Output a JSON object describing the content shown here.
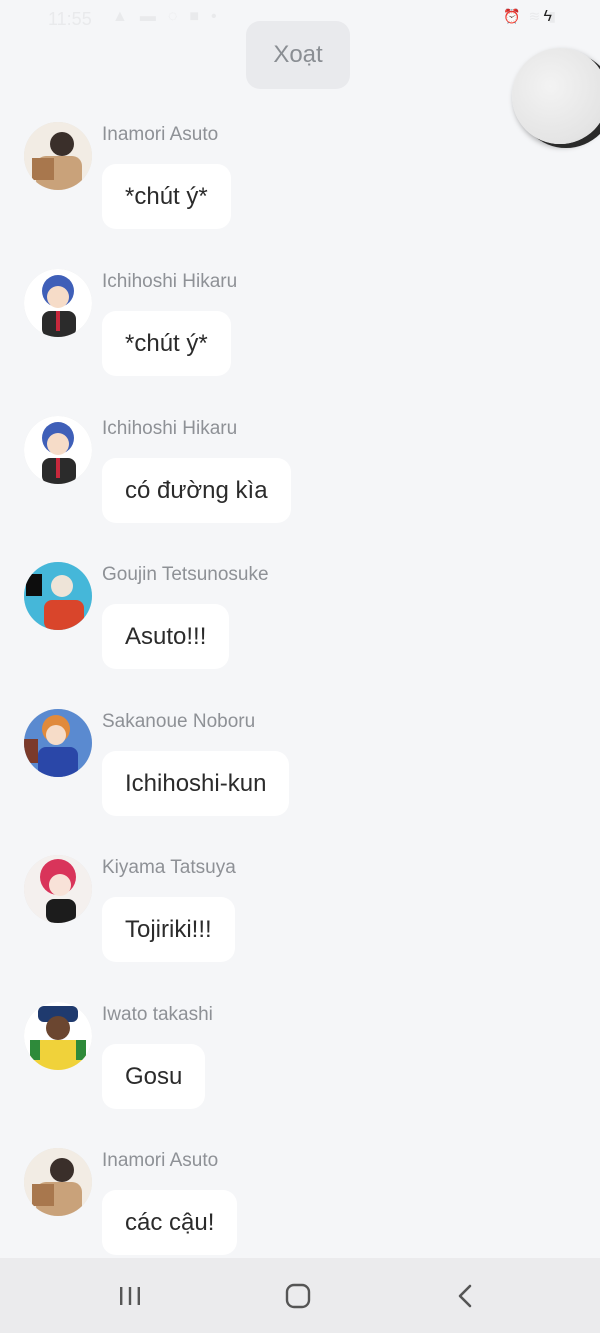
{
  "status_bar": {
    "time": "11:55",
    "left_icons": [
      "warning-icon",
      "message-icon",
      "messenger-icon",
      "facebook-icon",
      "dot-icon"
    ],
    "right_icons": [
      "alarm-icon",
      "wifi-icon",
      "signal-icon",
      "battery-charging-icon"
    ]
  },
  "toolbar": {
    "delete_label": "Xoạt"
  },
  "messages": [
    {
      "sender": "Inamori Asuto",
      "text": "*chút ý*",
      "avatar_color": "#c9a27a"
    },
    {
      "sender": "Ichihoshi Hikaru",
      "text": "*chút ý*",
      "avatar_color": "#3f5fb8"
    },
    {
      "sender": "Ichihoshi Hikaru",
      "text": "có đường kìa",
      "avatar_color": "#3f5fb8"
    },
    {
      "sender": "Goujin Tetsunosuke",
      "text": "Asuto!!!",
      "avatar_color": "#45b7d9"
    },
    {
      "sender": "Sakanoue Noboru",
      "text": "Ichihoshi-kun",
      "avatar_color": "#e08a3c"
    },
    {
      "sender": "Kiyama Tatsuya",
      "text": "Tojiriki!!!",
      "avatar_color": "#d9345a"
    },
    {
      "sender": "Iwato takashi",
      "text": "Gosu",
      "avatar_color": "#f0d23a"
    },
    {
      "sender": "Inamori Asuto",
      "text": "các cậu!",
      "avatar_color": "#c9a27a"
    }
  ],
  "nav_bar": {
    "recent_icon": "recent-apps-icon",
    "home_icon": "home-icon",
    "back_icon": "back-icon"
  }
}
